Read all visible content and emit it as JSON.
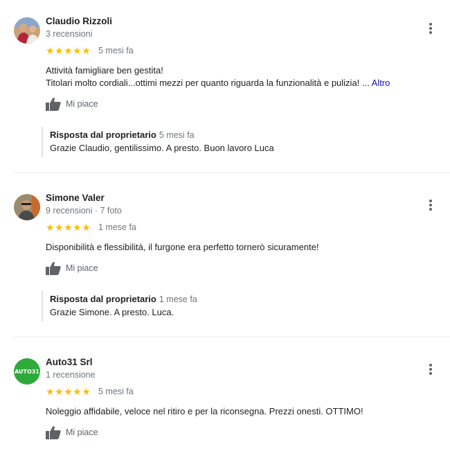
{
  "reviews": [
    {
      "name": "Claudio Rizzoli",
      "meta": "3 recensioni",
      "stars": "★★★★★",
      "date": "5 mesi fa",
      "text_line1": "Attività famigliare ben gestita!",
      "text_line2": "Titolari molto cordiali...ottimi mezzi per quanto riguarda la funzionalità e pulizia! ...",
      "more_label": "Altro",
      "like_label": "Mi piace",
      "reply_title": "Risposta dal proprietario",
      "reply_date": "5 mesi fa",
      "reply_text": "Grazie Claudio, gentilissimo. A presto. Buon lavoro Luca"
    },
    {
      "name": "Simone Valer",
      "meta": "9 recensioni · 7 foto",
      "stars": "★★★★★",
      "date": "1 mese fa",
      "text_line1": "Disponibilità e flessibilità, il furgone era perfetto tornerò sicuramente!",
      "like_label": "Mi piace",
      "reply_title": "Risposta dal proprietario",
      "reply_date": "1 mese fa",
      "reply_text": "Grazie Simone. A presto. Luca."
    },
    {
      "name": "Auto31 Srl",
      "meta": "1 recensione",
      "stars": "★★★★★",
      "date": "5 mesi fa",
      "text_line1": "Noleggio affidabile, veloce nel ritiro e per la riconsegna. Prezzi onesti. OTTIMO!",
      "like_label": "Mi piace",
      "avatar_text": "AUTO31"
    }
  ],
  "colors": {
    "star": "#fbbc04",
    "link": "#1a0dab",
    "auto31_avatar": "#2eaa3a"
  }
}
